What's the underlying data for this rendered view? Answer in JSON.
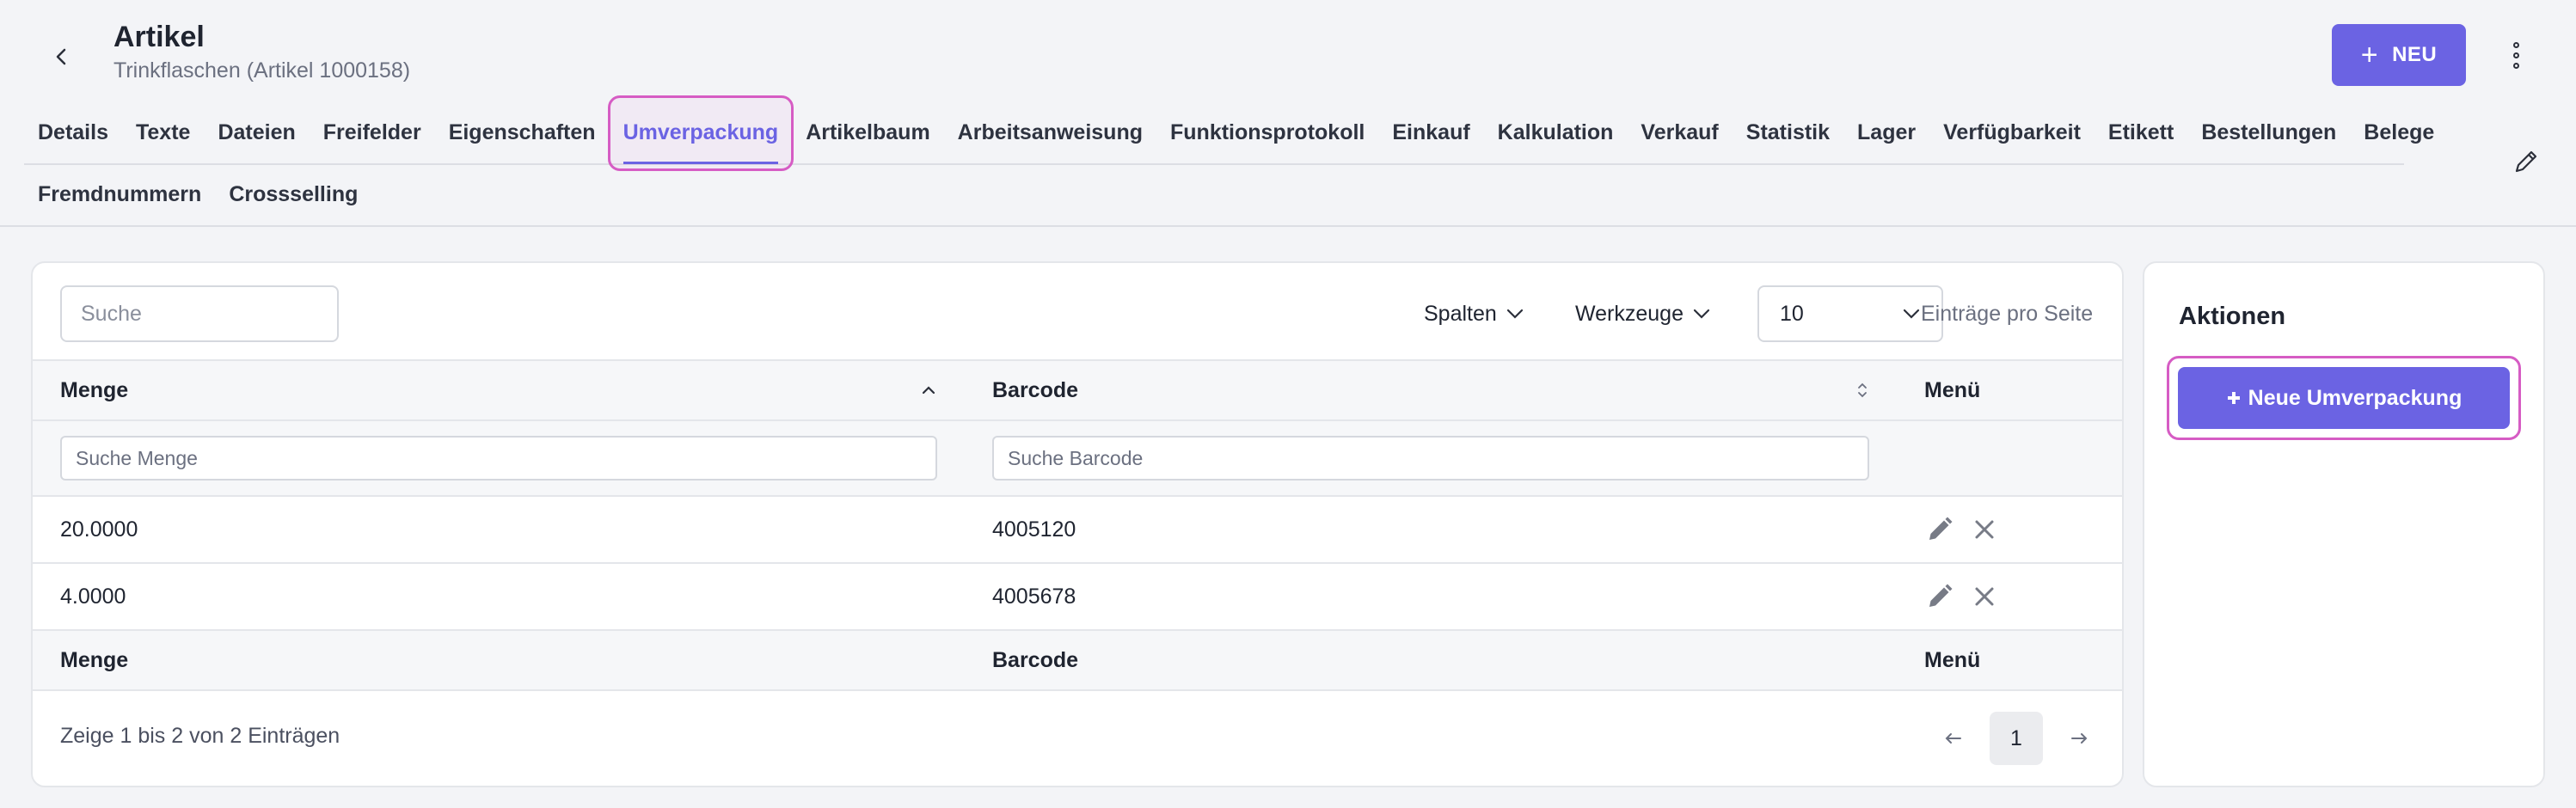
{
  "header": {
    "title": "Artikel",
    "subtitle": "Trinkflaschen (Artikel 1000158)",
    "new_button_label": "NEU"
  },
  "tabs_row1": [
    {
      "label": "Details"
    },
    {
      "label": "Texte"
    },
    {
      "label": "Dateien"
    },
    {
      "label": "Freifelder"
    },
    {
      "label": "Eigenschaften"
    },
    {
      "label": "Umverpackung",
      "active": true
    },
    {
      "label": "Artikelbaum"
    },
    {
      "label": "Arbeitsanweisung"
    },
    {
      "label": "Funktionsprotokoll"
    },
    {
      "label": "Einkauf"
    },
    {
      "label": "Kalkulation"
    },
    {
      "label": "Verkauf"
    },
    {
      "label": "Statistik"
    },
    {
      "label": "Lager"
    },
    {
      "label": "Verfügbarkeit"
    },
    {
      "label": "Etikett"
    },
    {
      "label": "Bestellungen"
    },
    {
      "label": "Belege"
    }
  ],
  "tabs_row2": [
    {
      "label": "Fremdnummern"
    },
    {
      "label": "Crossselling"
    }
  ],
  "toolbar": {
    "search_placeholder": "Suche",
    "columns_label": "Spalten",
    "tools_label": "Werkzeuge",
    "per_page_value": "10",
    "per_page_label": "Einträge pro Seite"
  },
  "table": {
    "columns": [
      "Menge",
      "Barcode",
      "Menü"
    ],
    "filter_placeholders": [
      "Suche Menge",
      "Suche Barcode"
    ],
    "rows": [
      {
        "menge": "20.0000",
        "barcode": "4005120"
      },
      {
        "menge": "4.0000",
        "barcode": "4005678"
      }
    ]
  },
  "pagination": {
    "info": "Zeige 1 bis 2 von 2 Einträgen",
    "current_page": "1"
  },
  "sidebar": {
    "title": "Aktionen",
    "button_label": "Neue Umverpackung"
  },
  "colors": {
    "accent": "#6b63e3",
    "highlight": "#d65cc4"
  }
}
